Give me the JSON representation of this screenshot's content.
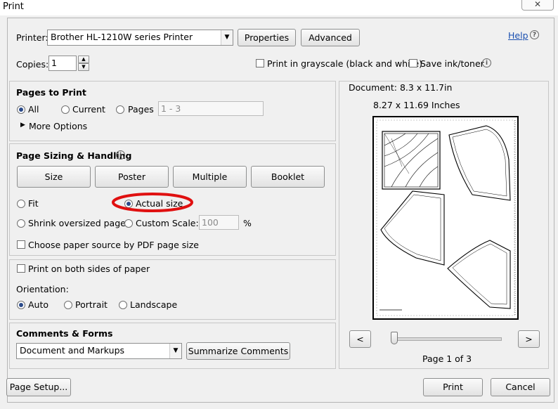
{
  "window": {
    "title": "Print"
  },
  "header": {
    "printer_label": "Printer:",
    "printer_value": "Brother HL-1210W series Printer",
    "properties_label": "Properties",
    "advanced_label": "Advanced",
    "help_label": "Help",
    "copies_label": "Copies:",
    "copies_value": "1",
    "grayscale_label": "Print in grayscale (black and white)",
    "save_ink_label": "Save ink/toner"
  },
  "pages_to_print": {
    "heading": "Pages to Print",
    "all_label": "All",
    "current_label": "Current",
    "pages_label": "Pages",
    "pages_value": "1 - 3",
    "more_options_label": "More Options"
  },
  "page_sizing": {
    "heading": "Page Sizing & Handling",
    "tabs": [
      {
        "label": "Size"
      },
      {
        "label": "Poster"
      },
      {
        "label": "Multiple"
      },
      {
        "label": "Booklet"
      }
    ],
    "fit_label": "Fit",
    "actual_size_label": "Actual size",
    "shrink_label": "Shrink oversized pages",
    "custom_scale_label": "Custom Scale:",
    "custom_scale_value": "100",
    "percent_label": "%",
    "paper_source_label": "Choose paper source by PDF page size",
    "annotation_color": "#e01010"
  },
  "duplex": {
    "both_sides_label": "Print on both sides of paper",
    "orientation_label": "Orientation:",
    "auto_label": "Auto",
    "portrait_label": "Portrait",
    "landscape_label": "Landscape"
  },
  "comments_forms": {
    "heading": "Comments & Forms",
    "select_value": "Document and Markups",
    "summarize_label": "Summarize Comments"
  },
  "preview": {
    "document_size": "Document: 8.3 x 11.7in",
    "page_size": "8.27 x 11.69 Inches",
    "prev_label": "<",
    "next_label": ">",
    "page_indicator": "Page 1 of 3",
    "slider_fraction": 0.0
  },
  "footer": {
    "page_setup_label": "Page Setup...",
    "print_label": "Print",
    "cancel_label": "Cancel"
  },
  "icons": {
    "close": "close-icon",
    "help": "help-icon",
    "info": "info-icon",
    "dropdown": "chevron-down-icon"
  }
}
